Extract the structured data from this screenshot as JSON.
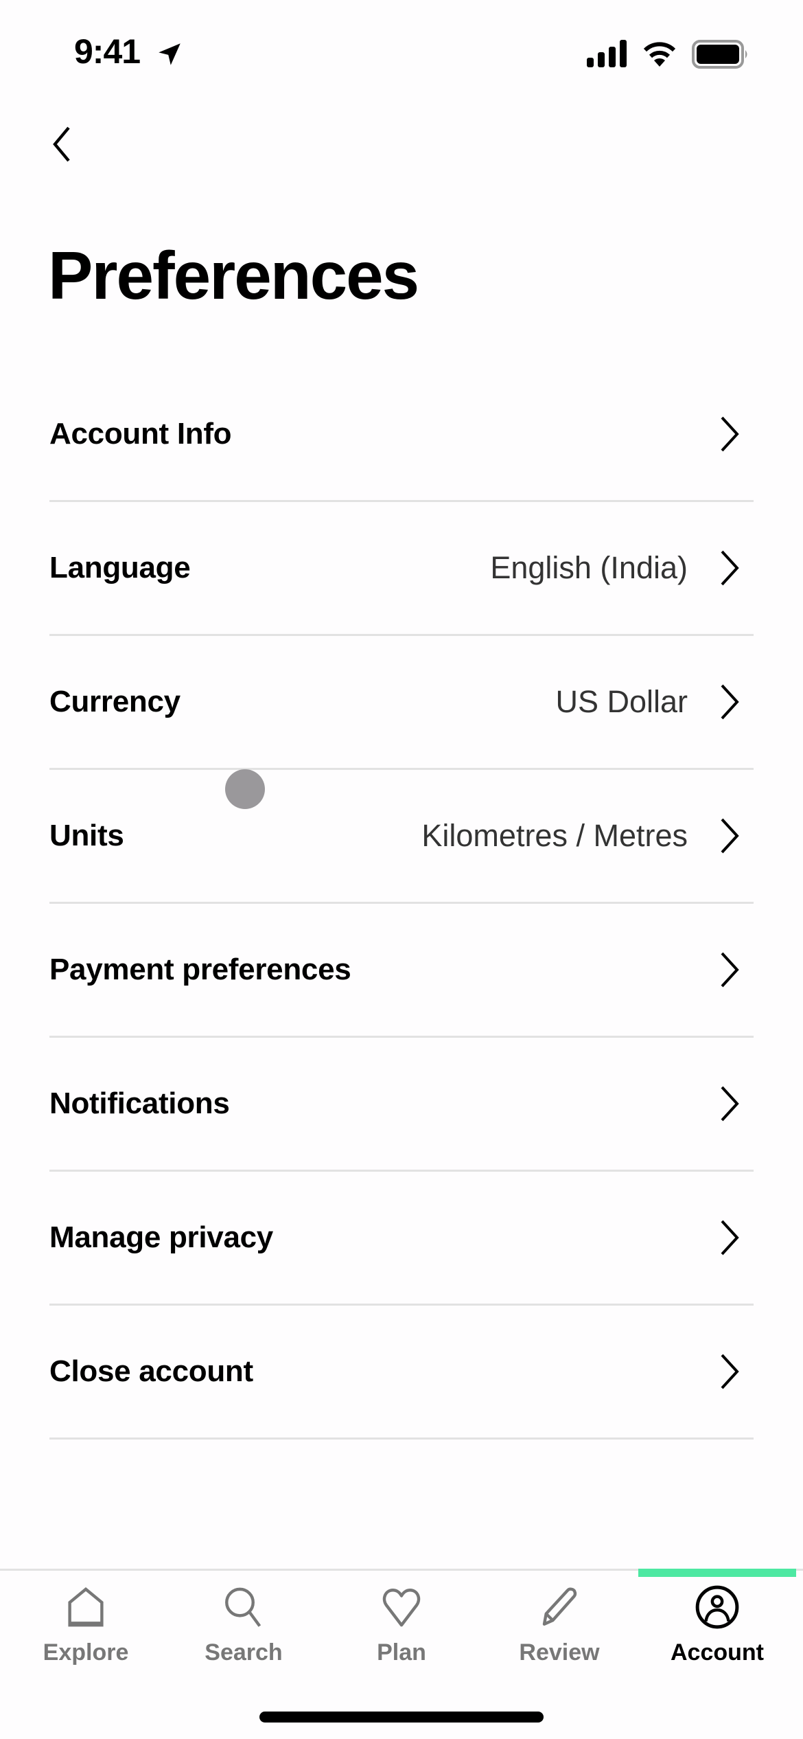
{
  "status_bar": {
    "time": "9:41",
    "icons": [
      "location-arrow-icon",
      "cellular-signal-icon",
      "wifi-icon",
      "battery-icon"
    ]
  },
  "nav": {
    "back_icon": "chevron-left-icon"
  },
  "page": {
    "title": "Preferences"
  },
  "menu": {
    "items": [
      {
        "label": "Account Info",
        "value": ""
      },
      {
        "label": "Language",
        "value": "English (India)"
      },
      {
        "label": "Currency",
        "value": "US Dollar"
      },
      {
        "label": "Units",
        "value": "Kilometres / Metres"
      },
      {
        "label": "Payment preferences",
        "value": ""
      },
      {
        "label": "Notifications",
        "value": ""
      },
      {
        "label": "Manage privacy",
        "value": ""
      },
      {
        "label": "Close account",
        "value": ""
      }
    ]
  },
  "tab_bar": {
    "active_color": "#4de8a2",
    "active_tab": "Account",
    "tabs": [
      {
        "label": "Explore",
        "icon": "home-icon"
      },
      {
        "label": "Search",
        "icon": "search-icon"
      },
      {
        "label": "Plan",
        "icon": "heart-icon"
      },
      {
        "label": "Review",
        "icon": "pencil-icon"
      },
      {
        "label": "Account",
        "icon": "user-circle-icon"
      }
    ]
  }
}
